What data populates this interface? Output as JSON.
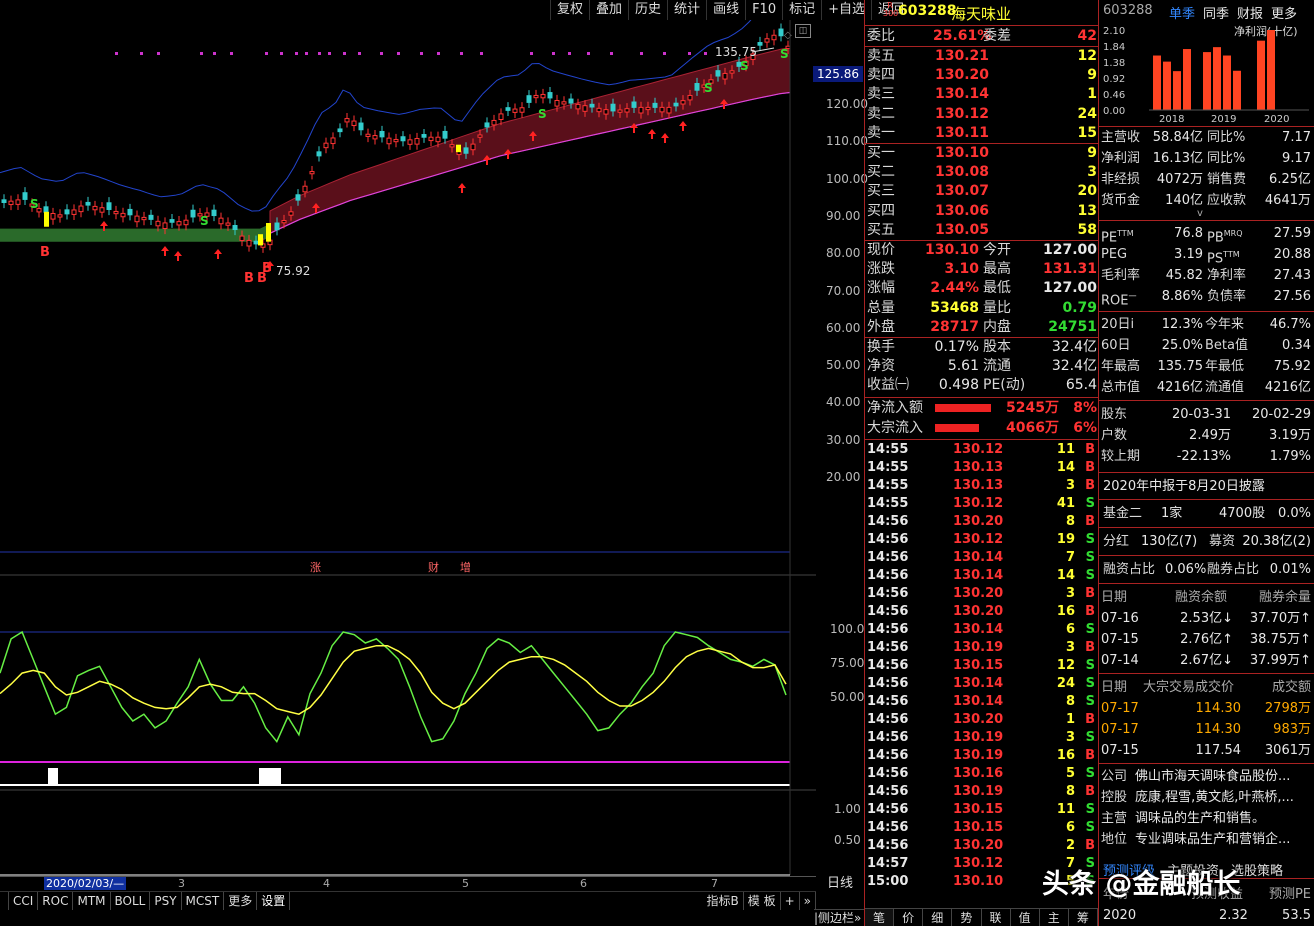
{
  "toolbar": {
    "items": [
      "复权",
      "叠加",
      "历史",
      "统计",
      "画线",
      "F10",
      "标记",
      "+自选",
      "返回"
    ]
  },
  "stock": {
    "badge_top": "R",
    "badge_bottom": "300",
    "code": "603288",
    "name": "海天味业"
  },
  "chart_marks": {
    "high_label": "135.75",
    "low_label": "75.92",
    "price_tag": "125.86",
    "s_mark": "S",
    "b_mark": "B",
    "divider_labels": [
      "涨",
      "财",
      "增"
    ]
  },
  "price_axis": [
    "120.00",
    "110.00",
    "100.00",
    "90.00",
    "80.00",
    "70.00",
    "60.00",
    "50.00",
    "40.00",
    "30.00",
    "20.00"
  ],
  "osc_axis": [
    "100.0",
    "75.00",
    "50.00"
  ],
  "vol_axis": [
    "1.00",
    "0.50"
  ],
  "date_axis": {
    "start": "2020/02/03/—",
    "labels": [
      "3",
      "4",
      "5",
      "6",
      "7"
    ],
    "period": "日线"
  },
  "indicator_tabs": [
    "CCI",
    "ROC",
    "MTM",
    "BOLL",
    "PSY",
    "MCST",
    "更多",
    "设置"
  ],
  "bottom_right_btns": [
    "指标B",
    "模 板",
    "+",
    "»"
  ],
  "side_toggle": "|侧边栏»",
  "bottom_tabs": [
    "笔",
    "价",
    "细",
    "势",
    "联",
    "值",
    "主",
    "筹"
  ],
  "weibi": {
    "label1": "委比",
    "value1": "25.61%",
    "label2": "委差",
    "value2": "42"
  },
  "asks": [
    {
      "label": "卖五",
      "price": "130.21",
      "vol": "12"
    },
    {
      "label": "卖四",
      "price": "130.20",
      "vol": "9"
    },
    {
      "label": "卖三",
      "price": "130.14",
      "vol": "1"
    },
    {
      "label": "卖二",
      "price": "130.12",
      "vol": "24"
    },
    {
      "label": "卖一",
      "price": "130.11",
      "vol": "15"
    }
  ],
  "bids": [
    {
      "label": "买一",
      "price": "130.10",
      "vol": "9"
    },
    {
      "label": "买二",
      "price": "130.08",
      "vol": "3"
    },
    {
      "label": "买三",
      "price": "130.07",
      "vol": "20"
    },
    {
      "label": "买四",
      "price": "130.06",
      "vol": "13"
    },
    {
      "label": "买五",
      "price": "130.05",
      "vol": "58"
    }
  ],
  "quote": [
    {
      "l1": "现价",
      "v1": "130.10",
      "c1": "red",
      "l2": "今开",
      "v2": "127.00",
      "c2": "wht"
    },
    {
      "l1": "涨跌",
      "v1": "3.10",
      "c1": "red",
      "l2": "最高",
      "v2": "131.31",
      "c2": "red"
    },
    {
      "l1": "涨幅",
      "v1": "2.44%",
      "c1": "red",
      "l2": "最低",
      "v2": "127.00",
      "c2": "wht"
    },
    {
      "l1": "总量",
      "v1": "53468",
      "c1": "yel",
      "l2": "量比",
      "v2": "0.79",
      "c2": "grn"
    },
    {
      "l1": "外盘",
      "v1": "28717",
      "c1": "red",
      "l2": "内盘",
      "v2": "24751",
      "c2": "grn"
    }
  ],
  "quote2": [
    {
      "l1": "换手",
      "v1": "0.17%",
      "l2": "股本",
      "v2": "32.4亿"
    },
    {
      "l1": "净资",
      "v1": "5.61",
      "l2": "流通",
      "v2": "32.4亿"
    },
    {
      "l1": "收益㈠",
      "v1": "0.498",
      "l2": "PE(动)",
      "v2": "65.4"
    }
  ],
  "flows": [
    {
      "label": "净流入额",
      "value": "5245万",
      "pct": "8%"
    },
    {
      "label": "大宗流入",
      "value": "4066万",
      "pct": "6%"
    }
  ],
  "ticks": [
    {
      "t": "14:55",
      "p": "130.12",
      "v": "11",
      "d": "B"
    },
    {
      "t": "14:55",
      "p": "130.13",
      "v": "14",
      "d": "B"
    },
    {
      "t": "14:55",
      "p": "130.13",
      "v": "3",
      "d": "B"
    },
    {
      "t": "14:55",
      "p": "130.12",
      "v": "41",
      "d": "S"
    },
    {
      "t": "14:56",
      "p": "130.20",
      "v": "8",
      "d": "B"
    },
    {
      "t": "14:56",
      "p": "130.12",
      "v": "19",
      "d": "S"
    },
    {
      "t": "14:56",
      "p": "130.14",
      "v": "7",
      "d": "S"
    },
    {
      "t": "14:56",
      "p": "130.14",
      "v": "14",
      "d": "S"
    },
    {
      "t": "14:56",
      "p": "130.20",
      "v": "3",
      "d": "B"
    },
    {
      "t": "14:56",
      "p": "130.20",
      "v": "16",
      "d": "B"
    },
    {
      "t": "14:56",
      "p": "130.14",
      "v": "6",
      "d": "S"
    },
    {
      "t": "14:56",
      "p": "130.19",
      "v": "3",
      "d": "B"
    },
    {
      "t": "14:56",
      "p": "130.15",
      "v": "12",
      "d": "S"
    },
    {
      "t": "14:56",
      "p": "130.14",
      "v": "24",
      "d": "S"
    },
    {
      "t": "14:56",
      "p": "130.14",
      "v": "8",
      "d": "S"
    },
    {
      "t": "14:56",
      "p": "130.20",
      "v": "1",
      "d": "B"
    },
    {
      "t": "14:56",
      "p": "130.19",
      "v": "3",
      "d": "S"
    },
    {
      "t": "14:56",
      "p": "130.19",
      "v": "16",
      "d": "B"
    },
    {
      "t": "14:56",
      "p": "130.16",
      "v": "5",
      "d": "S"
    },
    {
      "t": "14:56",
      "p": "130.19",
      "v": "8",
      "d": "B"
    },
    {
      "t": "14:56",
      "p": "130.15",
      "v": "11",
      "d": "S"
    },
    {
      "t": "14:56",
      "p": "130.15",
      "v": "6",
      "d": "S"
    },
    {
      "t": "14:56",
      "p": "130.20",
      "v": "2",
      "d": "B"
    },
    {
      "t": "14:57",
      "p": "130.12",
      "v": "7",
      "d": "S"
    },
    {
      "t": "15:00",
      "p": "130.10",
      "v": "5",
      "d": "S"
    }
  ],
  "f10_header": {
    "code": "603288",
    "tabs": [
      "单季",
      "同季",
      "财报",
      "更多"
    ]
  },
  "profit_chart": {
    "title": "净利润(十亿)",
    "yticks": [
      "2.10",
      "1.84",
      "1.38",
      "0.92",
      "0.46",
      "0.00"
    ],
    "xlabels": [
      "2018",
      "2019",
      "2020"
    ],
    "values": [
      1.43,
      1.27,
      1.02,
      1.6,
      1.52,
      1.65,
      1.43,
      1.03,
      1.82,
      2.1
    ]
  },
  "fin_rows_a": [
    {
      "l1": "主营收",
      "v1": "58.84亿",
      "l2": "同比%",
      "v2": "7.17"
    },
    {
      "l1": "净利润",
      "v1": "16.13亿",
      "l2": "同比%",
      "v2": "9.17"
    },
    {
      "l1": "非经损",
      "v1": "4072万",
      "l2": "销售费",
      "v2": "6.25亿"
    },
    {
      "l1": "货币金",
      "v1": "140亿",
      "l2": "应收款",
      "v2": "4641万"
    }
  ],
  "fin_rows_b": [
    {
      "l1": "PE",
      "s1": "TTM",
      "v1": "76.8",
      "l2": "PB",
      "s2": "MRQ",
      "v2": "27.59"
    },
    {
      "l1": "PEG",
      "s1": "",
      "v1": "3.19",
      "l2": "PS",
      "s2": "TTM",
      "v2": "20.88"
    },
    {
      "l1": "毛利率",
      "s1": "",
      "v1": "45.82",
      "l2": "净利率",
      "s2": "",
      "v2": "27.43"
    },
    {
      "l1": "ROE",
      "s1": "一",
      "v1": "8.86%",
      "l2": "负债率",
      "s2": "",
      "v2": "27.56"
    }
  ],
  "fin_rows_c": [
    {
      "l1": "20日i",
      "v1": "12.3%",
      "l2": "今年来",
      "v2": "46.7%"
    },
    {
      "l1": "60日",
      "v1": "25.0%",
      "l2": "Beta值",
      "v2": "0.34"
    },
    {
      "l1": "年最高",
      "v1": "135.75",
      "l2": "年最低",
      "v2": "75.92"
    },
    {
      "l1": "总市值",
      "v1": "4216亿",
      "l2": "流通值",
      "v2": "4216亿"
    }
  ],
  "holders": {
    "rows": [
      {
        "l": "股东",
        "a": "20-03-31",
        "b": "20-02-29"
      },
      {
        "l": "户数",
        "a": "2.49万",
        "b": "3.19万"
      },
      {
        "l": "较上期",
        "a": "-22.13%",
        "b": "1.79%"
      }
    ]
  },
  "disclosure": "2020年中报于8月20日披露",
  "fund": {
    "l": "基金二",
    "a": "1家",
    "b": "4700股",
    "c": "0.0%"
  },
  "dividend": {
    "l1": "分红",
    "v1": "130亿(7)",
    "l2": "募资",
    "v2": "20.38亿(2)"
  },
  "margin_ratio": {
    "l1": "融资占比",
    "v1": "0.06%",
    "l2": "融券占比",
    "v2": "0.01%"
  },
  "margin": {
    "headers": [
      "日期",
      "融资余额",
      "融券余量"
    ],
    "rows": [
      {
        "d": "07-16",
        "a": "2.53亿↓",
        "b": "37.70万↑"
      },
      {
        "d": "07-15",
        "a": "2.76亿↑",
        "b": "38.75万↑"
      },
      {
        "d": "07-14",
        "a": "2.67亿↓",
        "b": "37.99万↑"
      }
    ]
  },
  "block": {
    "headers": [
      "日期",
      "大宗交易成交价",
      "成交额"
    ],
    "rows": [
      {
        "d": "07-17",
        "p": "114.30",
        "v": "2798万"
      },
      {
        "d": "07-17",
        "p": "114.30",
        "v": "983万"
      },
      {
        "d": "07-15",
        "p": "117.54",
        "v": "3061万"
      }
    ]
  },
  "company": [
    {
      "l": "公司",
      "v": "佛山市海天调味食品股份..."
    },
    {
      "l": "控股",
      "v": "庞康,程雪,黄文彪,叶燕桥,..."
    },
    {
      "l": "主营",
      "v": "调味品的生产和销售。"
    },
    {
      "l": "地位",
      "v": "专业调味品生产和营销企..."
    }
  ],
  "forecast_tabs": [
    "预测评级",
    "主题投资",
    "选股策略"
  ],
  "forecast": {
    "headers": [
      "年份",
      "预测收益",
      "预测PE"
    ],
    "year": "2020",
    "eps": "2.32",
    "pe": "53.5"
  },
  "watermark": "头条 @金融船长",
  "colors": {
    "up": "#ff3333",
    "down": "#33dd33",
    "ma_band": "#5a0f1a",
    "k_line": "#66ee44",
    "d_line": "#ffff44",
    "axis_blue": "#2244aa"
  }
}
